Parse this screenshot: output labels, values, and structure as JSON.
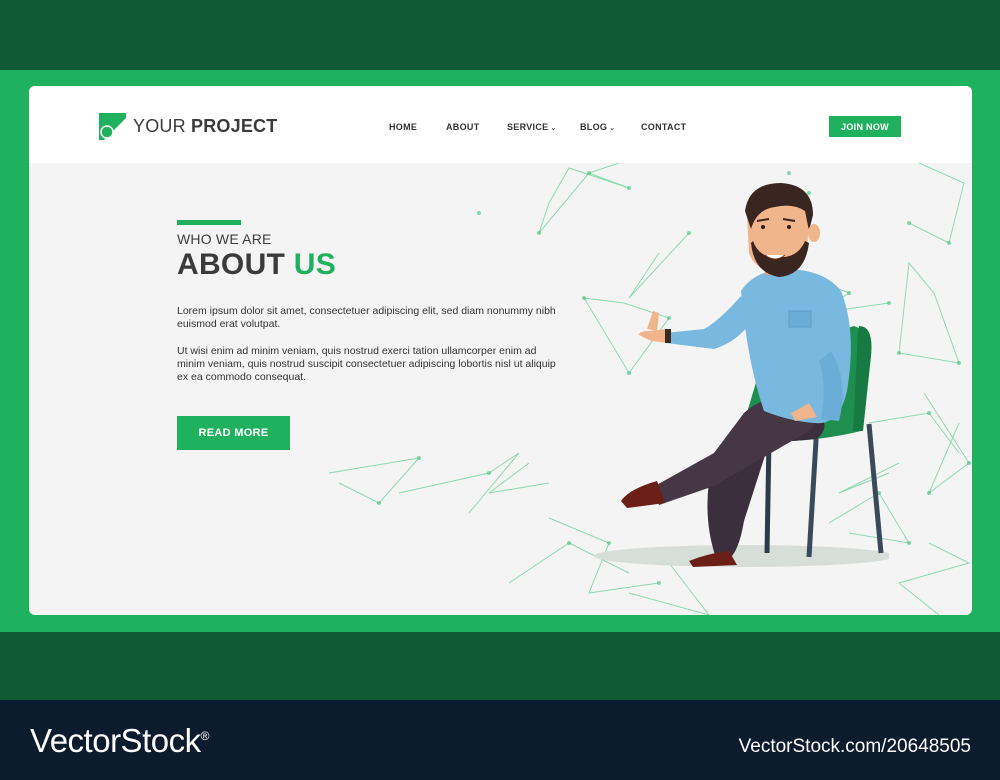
{
  "header": {
    "brand_prefix": "YOUR ",
    "brand_bold": "PROJECT",
    "nav": [
      {
        "label": "HOME",
        "has_dropdown": false
      },
      {
        "label": "ABOUT",
        "has_dropdown": false
      },
      {
        "label": "SERVICE",
        "has_dropdown": true
      },
      {
        "label": "BLOG",
        "has_dropdown": true
      },
      {
        "label": "CONTACT",
        "has_dropdown": false
      }
    ],
    "join_label": "JOIN NOW"
  },
  "hero": {
    "eyebrow": "WHO WE ARE",
    "title_main": "ABOUT ",
    "title_accent": "US",
    "paragraph1": "Lorem ipsum dolor sit amet, consectetuer adipiscing elit, sed diam nonummy nibh euismod erat volutpat.",
    "paragraph2": "Ut wisi enim ad minim veniam, quis nostrud exerci tation ullamcorper enim ad minim veniam, quis nostrud suscipit consectetuer adipiscing  lobortis nisl ut aliquip ex ea commodo consequat.",
    "button_label": "READ MORE"
  },
  "watermark": {
    "brand": "VectorStock",
    "trademark": "®",
    "site_id": "VectorStock.com/20648505"
  },
  "colors": {
    "accent": "#1fb15e",
    "dark_green": "#0f5a33",
    "footer": "#0c1b2e",
    "card_bg": "#f4f4f4"
  }
}
